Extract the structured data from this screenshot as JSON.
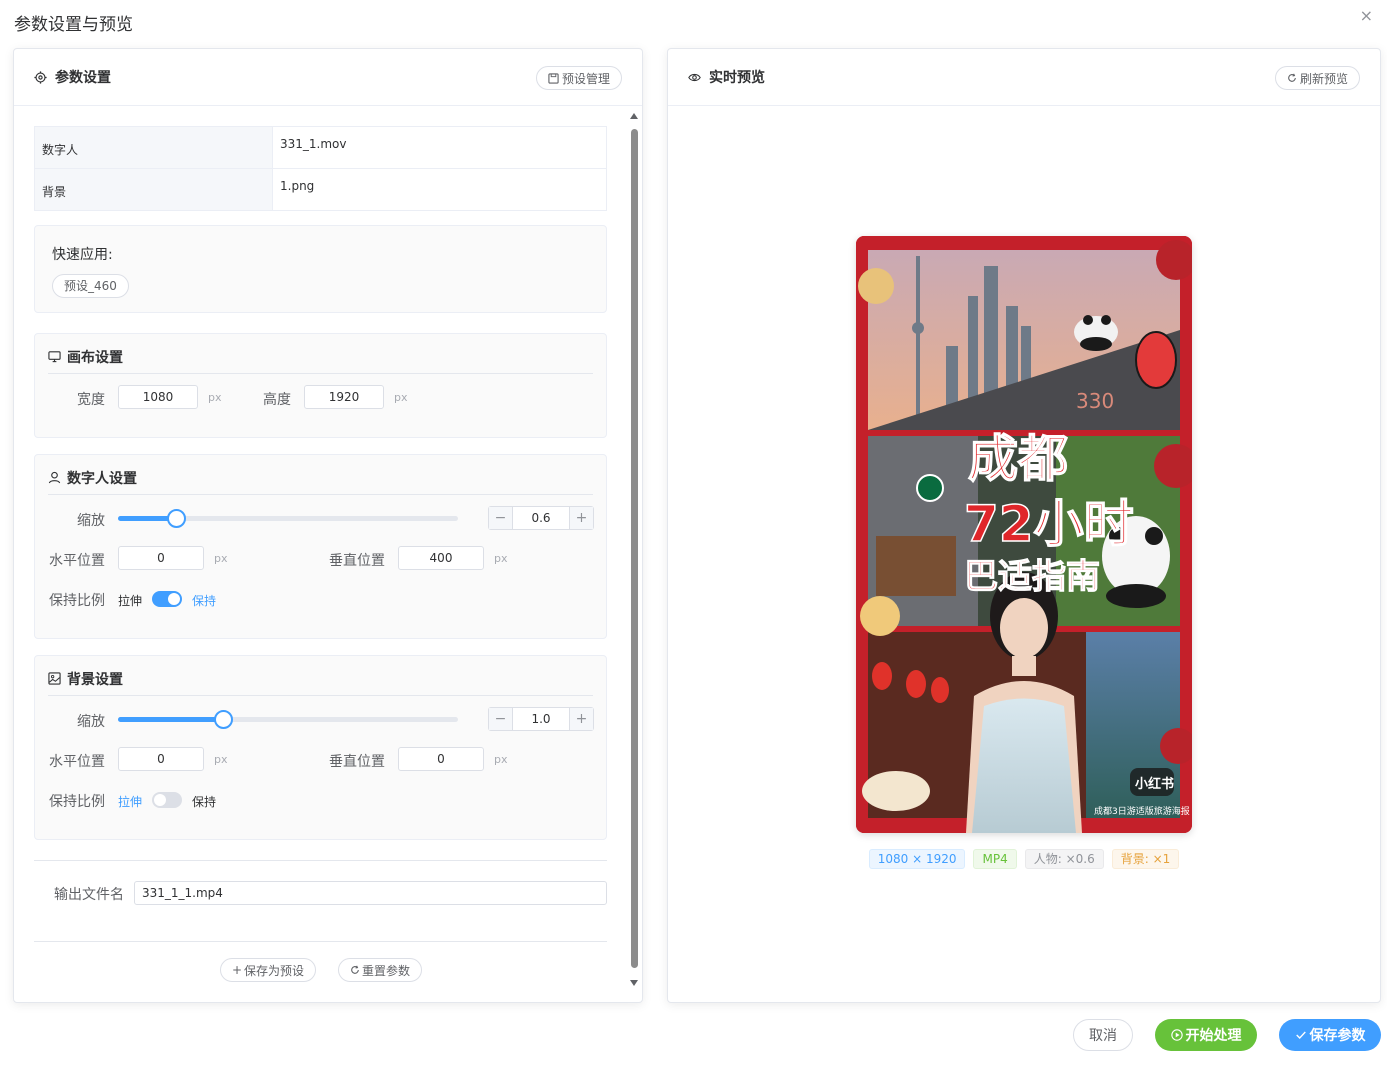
{
  "dialog": {
    "title": "参数设置与预览",
    "close": "×"
  },
  "left": {
    "title": "参数设置",
    "preset_btn": "预设管理",
    "info": [
      {
        "key": "数字人",
        "value": "331_1.mov"
      },
      {
        "key": "背景",
        "value": "1.png"
      }
    ],
    "quick": {
      "label": "快速应用:",
      "chip": "预设_460"
    },
    "canvas": {
      "title": "画布设置",
      "width_label": "宽度",
      "width": "1080",
      "height_label": "高度",
      "height": "1920",
      "unit": "px"
    },
    "avatar": {
      "title": "数字人设置",
      "scale_label": "缩放",
      "scale": "0.6",
      "scale_fraction": 0.17,
      "x_label": "水平位置",
      "x": "0",
      "y_label": "垂直位置",
      "y": "400",
      "unit": "px",
      "ratio_label": "保持比例",
      "stretch": "拉伸",
      "keep": "保持",
      "keep_on": true
    },
    "background": {
      "title": "背景设置",
      "scale_label": "缩放",
      "scale": "1.0",
      "scale_fraction": 0.31,
      "x_label": "水平位置",
      "x": "0",
      "y_label": "垂直位置",
      "y": "0",
      "unit": "px",
      "ratio_label": "保持比例",
      "stretch": "拉伸",
      "keep": "保持",
      "keep_on": false
    },
    "output": {
      "label": "输出文件名",
      "value": "331_1_1.mp4"
    },
    "save_preset": "保存为预设",
    "reset": "重置参数",
    "stepper_minus": "−",
    "stepper_plus": "+"
  },
  "right": {
    "title": "实时预览",
    "refresh": "刷新预览",
    "poster": {
      "title_line1": "成都",
      "title_line2": "72小时",
      "title_line3": "巴适指南",
      "badge": "330",
      "brand": "小红书",
      "caption": "成都3日游适版旅游海报"
    },
    "tags": [
      {
        "text": "1080 × 1920",
        "color": "#409eff",
        "bg": "#ecf5ff",
        "border": "#d9ecff"
      },
      {
        "text": "MP4",
        "color": "#67c23a",
        "bg": "#f0f9eb",
        "border": "#e1f3d8"
      },
      {
        "text": "人物: ×0.6",
        "color": "#909399",
        "bg": "#f4f4f5",
        "border": "#e9e9eb"
      },
      {
        "text": "背景: ×1",
        "color": "#e6a23c",
        "bg": "#fdf6ec",
        "border": "#faecd8"
      }
    ]
  },
  "footer": {
    "cancel": "取消",
    "start": "开始处理",
    "save": "保存参数"
  },
  "colors": {
    "primary": "#409eff",
    "success": "#67c23a",
    "poster_red": "#c4202a"
  }
}
